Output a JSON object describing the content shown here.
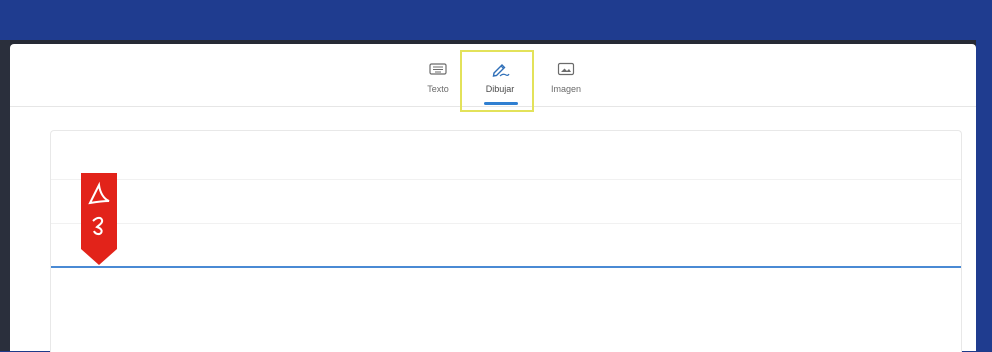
{
  "tabs": [
    {
      "label": "Texto",
      "icon": "keyboard-icon",
      "active": false
    },
    {
      "label": "Dibujar",
      "icon": "pen-draw-icon",
      "active": true
    },
    {
      "label": "Imagen",
      "icon": "image-icon",
      "active": false
    }
  ],
  "colors": {
    "background_band": "#1f3c8f",
    "accent": "#2f7fd1",
    "highlight": "#e3e25a",
    "acrobat_red": "#e2231a"
  },
  "canvas": {
    "logo": "adobe-acrobat-logo-icon"
  }
}
